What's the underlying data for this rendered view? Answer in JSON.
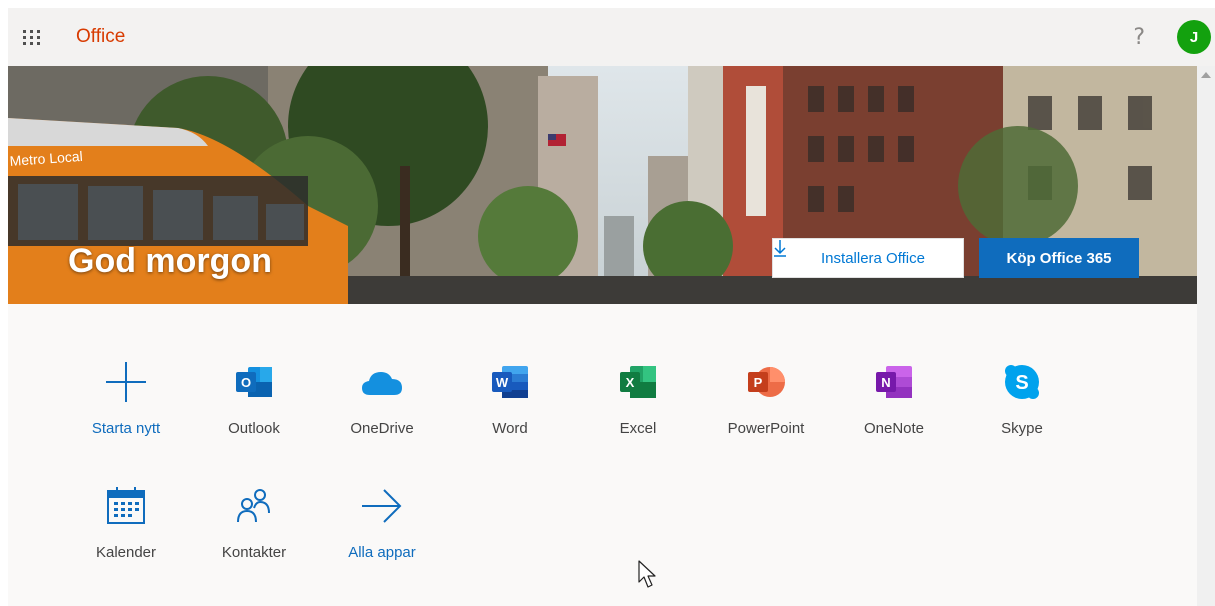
{
  "header": {
    "brand": "Office",
    "help": "?",
    "avatar_initial": "J"
  },
  "hero": {
    "greeting": "God morgon",
    "install_label": "Installera Office",
    "buy_label": "Köp Office 365",
    "bus_sign": "Metro Local"
  },
  "apps_row1": [
    {
      "label": "Starta nytt"
    },
    {
      "label": "Outlook"
    },
    {
      "label": "OneDrive"
    },
    {
      "label": "Word"
    },
    {
      "label": "Excel"
    },
    {
      "label": "PowerPoint"
    },
    {
      "label": "OneNote"
    },
    {
      "label": "Skype"
    }
  ],
  "apps_row2": [
    {
      "label": "Kalender"
    },
    {
      "label": "Kontakter"
    },
    {
      "label": "Alla appar"
    }
  ],
  "colors": {
    "brand": "#d83b01",
    "accent": "#0f6cbd",
    "avatar": "#13a10e"
  }
}
